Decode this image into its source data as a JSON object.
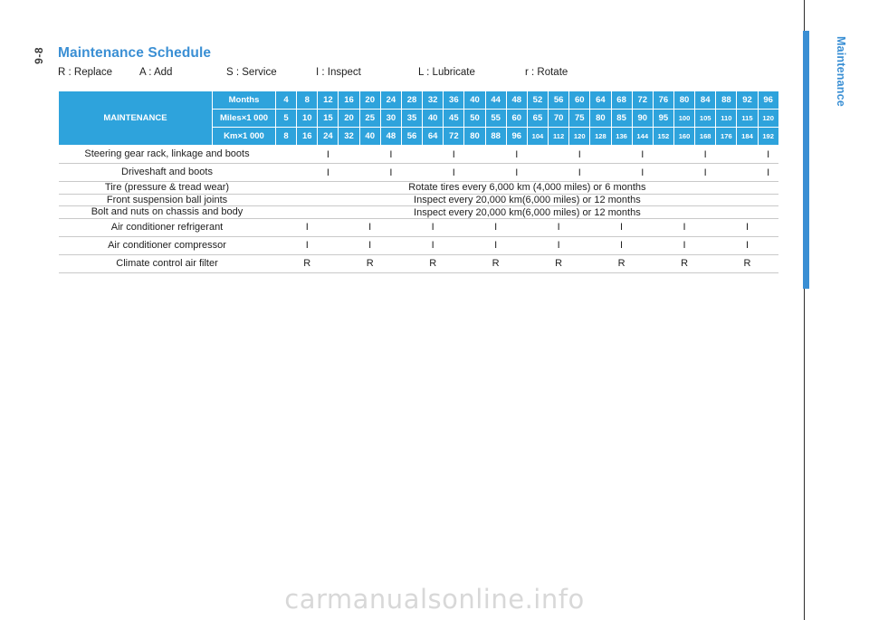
{
  "page": {
    "number": "9-8",
    "side_tab_label": "Maintenance",
    "title": "Maintenance Schedule",
    "watermark": "carmanualsonline.info"
  },
  "legend": [
    "R : Replace",
    "A : Add",
    "S : Service",
    "I : Inspect",
    "L : Lubricate",
    "r : Rotate"
  ],
  "table": {
    "corner_label": "MAINTENANCE",
    "unit_rows": [
      {
        "label": "Months",
        "values": [
          "4",
          "8",
          "12",
          "16",
          "20",
          "24",
          "28",
          "32",
          "36",
          "40",
          "44",
          "48",
          "52",
          "56",
          "60",
          "64",
          "68",
          "72",
          "76",
          "80",
          "84",
          "88",
          "92",
          "96"
        ],
        "small_from": 99
      },
      {
        "label": "Miles×1 000",
        "values": [
          "5",
          "10",
          "15",
          "20",
          "25",
          "30",
          "35",
          "40",
          "45",
          "50",
          "55",
          "60",
          "65",
          "70",
          "75",
          "80",
          "85",
          "90",
          "95",
          "100",
          "105",
          "110",
          "115",
          "120"
        ],
        "small_from": 19
      },
      {
        "label": "Km×1 000",
        "values": [
          "8",
          "16",
          "24",
          "32",
          "40",
          "48",
          "56",
          "64",
          "72",
          "80",
          "88",
          "96",
          "104",
          "112",
          "120",
          "128",
          "136",
          "144",
          "152",
          "160",
          "168",
          "176",
          "184",
          "192"
        ],
        "small_from": 12
      }
    ],
    "rows": [
      {
        "name": "Steering gear rack, linkage and boots",
        "type": "cells",
        "values": [
          "",
          "",
          "I",
          "",
          "I",
          "",
          "I",
          "",
          "I",
          "",
          "I",
          "",
          "I",
          "",
          "I",
          "",
          "I"
        ]
      },
      {
        "name": "Driveshaft and boots",
        "type": "cells",
        "values": [
          "",
          "",
          "I",
          "",
          "I",
          "",
          "I",
          "",
          "I",
          "",
          "I",
          "",
          "I",
          "",
          "I",
          "",
          "I"
        ]
      },
      {
        "name": "Tire (pressure & tread wear)",
        "type": "span",
        "message": "Rotate tires every 6,000 km (4,000 miles) or 6 months"
      },
      {
        "name": "Front suspension ball joints",
        "type": "span",
        "message": "Inspect every 20,000 km(6,000 miles) or 12 months"
      },
      {
        "name": "Bolt and nuts on chassis and body",
        "type": "span",
        "message": "Inspect every 20,000 km(6,000 miles) or 12 months"
      },
      {
        "name": "Air conditioner refrigerant",
        "type": "cells",
        "values": [
          "",
          "I",
          "",
          "I",
          "",
          "I",
          "",
          "I",
          "",
          "I",
          "",
          "I",
          "",
          "I",
          "",
          "I"
        ]
      },
      {
        "name": "Air conditioner compressor",
        "type": "cells",
        "values": [
          "",
          "I",
          "",
          "I",
          "",
          "I",
          "",
          "I",
          "",
          "I",
          "",
          "I",
          "",
          "I",
          "",
          "I"
        ]
      },
      {
        "name": "Climate control air filter",
        "type": "cells",
        "values": [
          "",
          "R",
          "",
          "R",
          "",
          "R",
          "",
          "R",
          "",
          "R",
          "",
          "R",
          "",
          "R",
          "",
          "R"
        ]
      }
    ]
  },
  "colors": {
    "accent": "#3a8fd4",
    "table_header": "#2ea3dc",
    "grid": "#c9c9c9"
  }
}
